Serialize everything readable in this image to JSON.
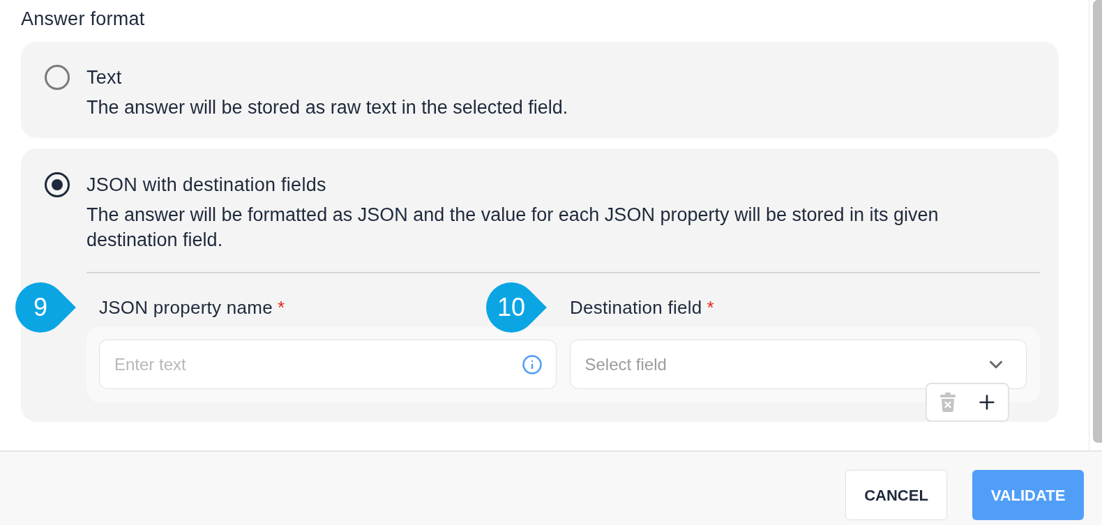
{
  "section": {
    "label": "Answer format"
  },
  "options": [
    {
      "title": "Text",
      "description": "The answer will be stored as raw text in the selected field.",
      "selected": false
    },
    {
      "title": "JSON with destination fields",
      "description": "The answer will be formatted as JSON and the value for each JSON property will be stored in its given destination field.",
      "selected": true,
      "mapping": {
        "columns": [
          {
            "label": "JSON property name",
            "required_mark": "*",
            "callout": "9",
            "field": {
              "kind": "text",
              "placeholder": "Enter text"
            }
          },
          {
            "label": "Destination field",
            "required_mark": "*",
            "callout": "10",
            "field": {
              "kind": "select",
              "placeholder": "Select field"
            }
          }
        ],
        "row_actions": [
          {
            "kind": "delete",
            "disabled": true
          },
          {
            "kind": "add",
            "disabled": false
          }
        ]
      }
    }
  ],
  "footer": {
    "buttons": [
      {
        "label": "CANCEL",
        "kind": "secondary"
      },
      {
        "label": "VALIDATE",
        "kind": "primary"
      }
    ]
  }
}
